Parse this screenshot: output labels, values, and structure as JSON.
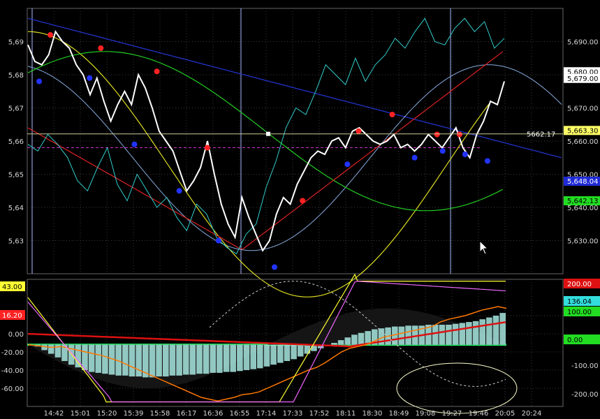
{
  "chart_data": [
    {
      "panel": "price",
      "type": "line",
      "ylim": [
        5620,
        5700
      ],
      "y_ticks": [
        {
          "v": 5630,
          "label": "5,63"
        },
        {
          "v": 5640,
          "label": "5,64"
        },
        {
          "v": 5650,
          "label": "5,65"
        },
        {
          "v": 5660,
          "label": "5,66"
        },
        {
          "v": 5670,
          "label": "5,67"
        },
        {
          "v": 5680,
          "label": "5,68"
        },
        {
          "v": 5690,
          "label": "5,69"
        }
      ],
      "right_ticks": [
        {
          "v": 5630,
          "label": "5,630.00"
        },
        {
          "v": 5640,
          "label": "5,640.00"
        },
        {
          "v": 5650,
          "label": "5,650.00"
        },
        {
          "v": 5660,
          "label": "5,660.00"
        },
        {
          "v": 5670,
          "label": "5,670.00"
        },
        {
          "v": 5680,
          "label": "5,680.00"
        },
        {
          "v": 5690,
          "label": "5,690.00"
        }
      ],
      "x_ticks": [
        "14:42",
        "15:01",
        "15:20",
        "15:39",
        "15:58",
        "16:17",
        "16:36",
        "16:55",
        "17:14",
        "17:33",
        "17:52",
        "18:11",
        "18:30",
        "18:49",
        "19:08",
        "19:27",
        "19:46",
        "20:05",
        "20:24"
      ],
      "price_series": [
        5689,
        5684,
        5683,
        5686,
        5693,
        5690,
        5688,
        5683,
        5680,
        5674,
        5679,
        5672,
        5666,
        5671,
        5675,
        5671,
        5680,
        5676,
        5670,
        5663,
        5660,
        5657,
        5651,
        5645,
        5648,
        5652,
        5660,
        5650,
        5641,
        5635,
        5631,
        5643,
        5637,
        5632,
        5627,
        5630,
        5638,
        5643,
        5641,
        5647,
        5651,
        5655,
        5657,
        5656,
        5660,
        5661,
        5658,
        5663,
        5664,
        5662,
        5660,
        5659,
        5660,
        5662,
        5658,
        5659,
        5657,
        5659,
        5662,
        5660,
        5658,
        5661,
        5664,
        5658,
        5655,
        5662,
        5666,
        5672,
        5671,
        5678
      ],
      "aux_series": [
        5659,
        5657,
        5662,
        5659,
        5655,
        5648,
        5645,
        5652,
        5658,
        5647,
        5642,
        5650,
        5645,
        5640,
        5643,
        5637,
        5633,
        5641,
        5638,
        5631,
        5628,
        5626,
        5632,
        5635,
        5646,
        5654,
        5664,
        5670,
        5668,
        5675,
        5683,
        5680,
        5677,
        5685,
        5678,
        5683,
        5686,
        5691,
        5688,
        5693,
        5697,
        5690,
        5689,
        5694,
        5697,
        5693,
        5696,
        5688,
        5691
      ],
      "last_price": "5662.17",
      "right_tags": [
        {
          "label": "5,690.00",
          "v": 5690,
          "color": "#000000",
          "text": "#d8d8d8"
        },
        {
          "label": "5,680.00",
          "v": 5681,
          "color": "#ffffff",
          "text": "#000000"
        },
        {
          "label": "5,679.00",
          "v": 5679,
          "color": "#ffffff",
          "text": "#000000"
        },
        {
          "label": "5,663.30",
          "v": 5663.3,
          "color": "#ffff66",
          "text": "#000000"
        },
        {
          "label": "5,648.04",
          "v": 5648,
          "color": "#1f2ad6",
          "text": "#ffffff"
        },
        {
          "label": "5,642.13",
          "v": 5642.1,
          "color": "#22dd22",
          "text": "#000000"
        }
      ],
      "swing_highs": [
        [
          4,
          5692
        ],
        [
          13,
          5688
        ],
        [
          23,
          5681
        ],
        [
          32,
          5658
        ],
        [
          49,
          5642
        ],
        [
          59,
          5663
        ],
        [
          65,
          5668
        ],
        [
          73,
          5662
        ],
        [
          77,
          5662
        ]
      ],
      "swing_lows": [
        [
          2,
          5678
        ],
        [
          11,
          5679
        ],
        [
          19,
          5659
        ],
        [
          27,
          5645
        ],
        [
          34,
          5630
        ],
        [
          44,
          5622
        ],
        [
          57,
          5653
        ],
        [
          69,
          5655
        ],
        [
          74,
          5657
        ],
        [
          78,
          5656
        ],
        [
          82,
          5654
        ]
      ],
      "colors": {
        "price": "#ffffff",
        "aux": "#33cccc",
        "blue_band": "#2233cc",
        "red_ma": "#dd2222",
        "yellow_wave": "#dddd22",
        "green_wave": "#22cc22",
        "light_blue_wave": "#88aadd",
        "swing_high": "#ff2222",
        "swing_low": "#2233ff"
      }
    },
    {
      "panel": "oscillator",
      "type": "bar",
      "ylim": [
        -80,
        60
      ],
      "left_ticks": [
        {
          "v": 20,
          "label": "20.00"
        },
        {
          "v": 0,
          "label": "0.00"
        },
        {
          "v": -20,
          "label": "-20.00"
        },
        {
          "v": -40,
          "label": "-40.00"
        },
        {
          "v": -60,
          "label": "-60.00"
        }
      ],
      "left_tags": [
        {
          "label": "43.00",
          "color": "#ffff33"
        },
        {
          "label": "16.20",
          "color": "#ff2222"
        }
      ],
      "right_ticks": [
        {
          "label": "-100.00"
        },
        {
          "label": "-200.00"
        }
      ],
      "right_tags": [
        {
          "label": "200.00",
          "color": "#dd1111",
          "text": "#ffffff"
        },
        {
          "label": "136.04",
          "color": "#33dddd",
          "text": "#000000"
        },
        {
          "label": "100.00",
          "color": "#22dd22",
          "text": "#000000"
        },
        {
          "label": "0.00",
          "color": "#22dd22",
          "text": "#000000"
        }
      ],
      "histogram": [
        0,
        -2,
        -6,
        -10,
        -14,
        -18,
        -22,
        -25,
        -28,
        -30,
        -31,
        -32,
        -33,
        -34,
        -34,
        -35,
        -35,
        -36,
        -36,
        -35,
        -35,
        -34,
        -34,
        -33,
        -33,
        -32,
        -32,
        -31,
        -31,
        -30,
        -30,
        -29,
        -28,
        -27,
        -26,
        -24,
        -22,
        -20,
        -18,
        -16,
        -13,
        -10,
        -7,
        -4,
        -1,
        2,
        5,
        8,
        11,
        13,
        15,
        17,
        18,
        19,
        20,
        20,
        21,
        21,
        21,
        22,
        22,
        22,
        22,
        23,
        24,
        25,
        26,
        28,
        30,
        32,
        35
      ],
      "orange_osc": [
        0,
        -1,
        -2,
        -3,
        -2,
        -4,
        -6,
        -8,
        -10,
        -12,
        -15,
        -18,
        -22,
        -26,
        -30,
        -34,
        -38,
        -42,
        -46,
        -50,
        -54,
        -58,
        -60,
        -62,
        -60,
        -58,
        -55,
        -54,
        -52,
        -48,
        -44,
        -40,
        -36,
        -32,
        -28,
        -25,
        -20,
        -14,
        -8,
        -4,
        -2,
        0,
        4,
        8,
        10,
        12,
        14,
        16,
        18,
        20,
        25,
        28,
        30,
        32,
        35,
        38,
        40,
        42,
        40
      ],
      "colors": {
        "histogram": "#a8e8e0",
        "orange": "#ff7700",
        "yellow": "#ffff33",
        "red": "#dd1111",
        "magenta": "#ee66ff",
        "baseline": "#22ee66"
      }
    }
  ]
}
